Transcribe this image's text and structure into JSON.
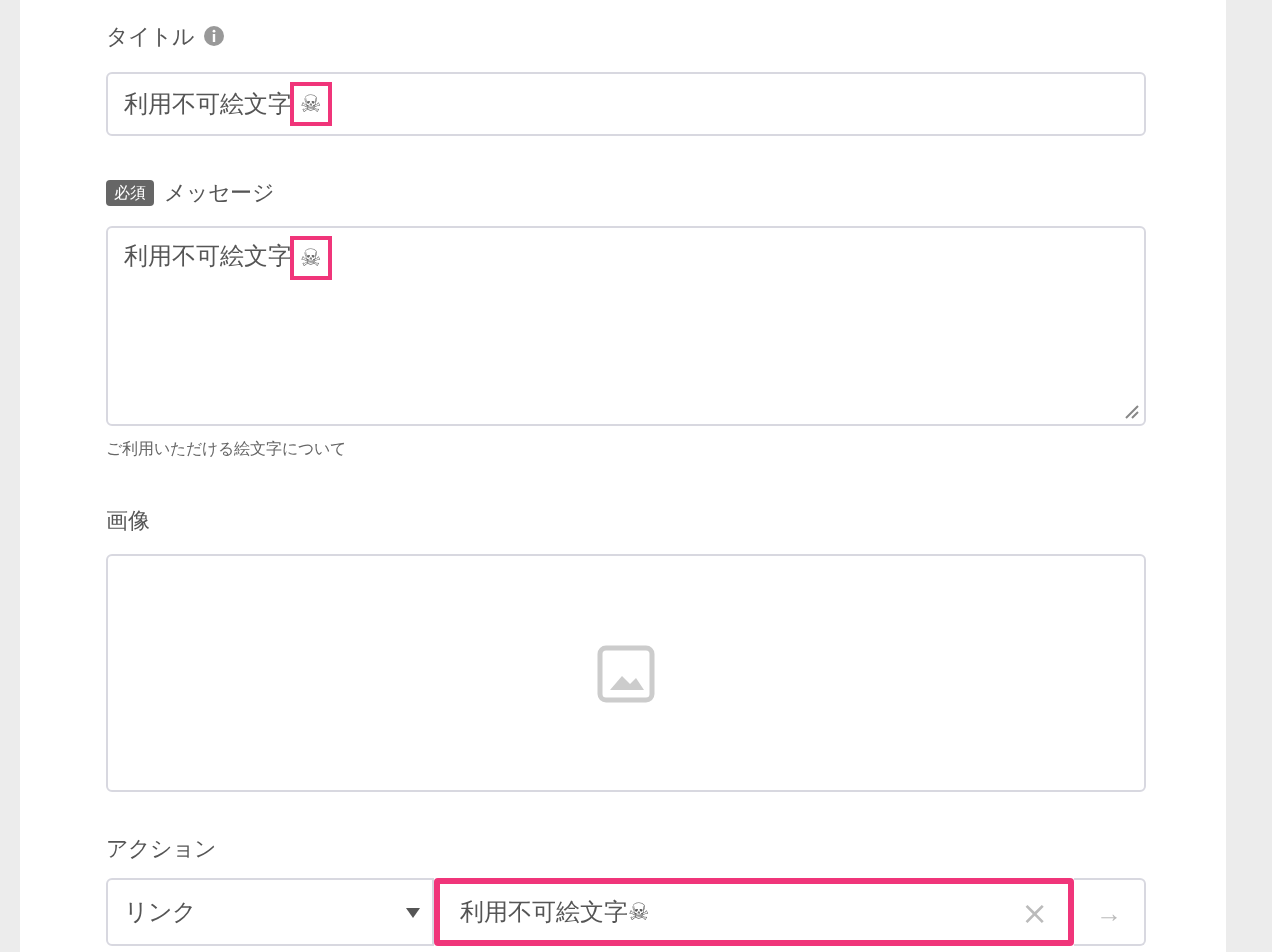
{
  "title_field": {
    "label": "タイトル",
    "value": "利用不可絵文字",
    "emoji": "☠",
    "highlighted": true
  },
  "message_field": {
    "badge": "必須",
    "label": "メッセージ",
    "value": "利用不可絵文字",
    "emoji": "☠",
    "highlighted": true,
    "help": "ご利用いただける絵文字について"
  },
  "image_field": {
    "label": "画像"
  },
  "action_field": {
    "label": "アクション",
    "type": "リンク",
    "value": "利用不可絵文字☠",
    "highlighted": true,
    "clear": "×",
    "go": "→"
  }
}
